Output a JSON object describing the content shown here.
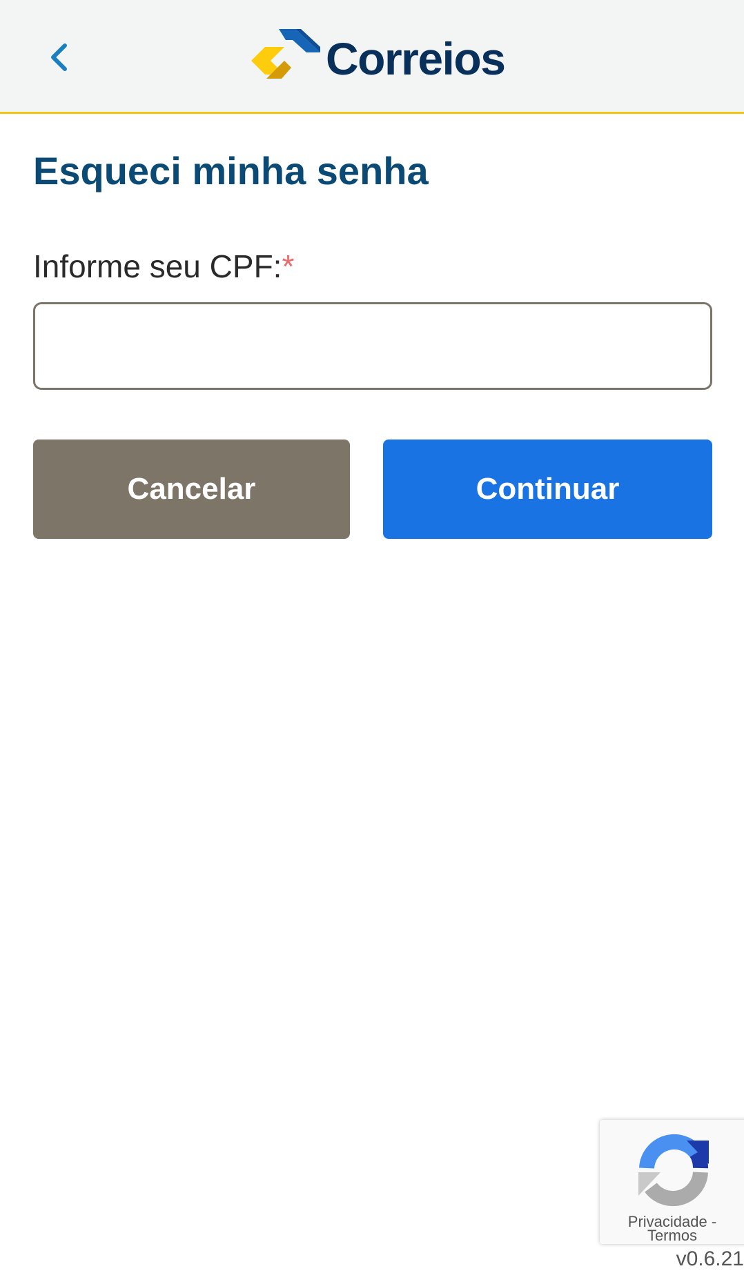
{
  "header": {
    "back_icon": "chevron-left-icon",
    "logo_text": "Correios",
    "colors": {
      "background": "#f3f4f4",
      "accent_line": "#f3c514",
      "back_icon": "#1a7fc1",
      "logo_text": "#08305a",
      "logo_blue": "#1665b7",
      "logo_yellow": "#fdcc0d"
    }
  },
  "page": {
    "title": "Esqueci minha senha",
    "title_color": "#0a4a75"
  },
  "form": {
    "cpf_label": "Informe seu CPF:",
    "required_mark": "*",
    "cpf_value": "",
    "cpf_placeholder": ""
  },
  "buttons": {
    "cancel_label": "Cancelar",
    "continue_label": "Continuar",
    "cancel_color": "#7e7569",
    "continue_color": "#1a73e3"
  },
  "recaptcha": {
    "icon": "recaptcha-icon",
    "privacy_label": "Privacidade",
    "separator": " - ",
    "terms_label": "Termos"
  },
  "footer": {
    "version": "v0.6.21"
  }
}
